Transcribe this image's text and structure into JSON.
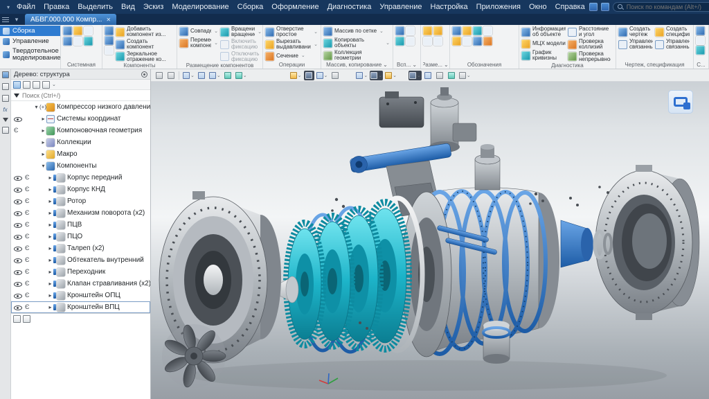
{
  "colors": {
    "menubar_bg": "#17375e",
    "accent_blue": "#2e7bd6",
    "active_tab_top": "#4e93d9",
    "active_tab_bottom": "#2b66a8",
    "ribbon_bg": "#f2f3f4",
    "viewport_top": "#c6ccd1",
    "viewport_bottom": "#999fa6",
    "rotor_cyan": "#1db4c9",
    "part_blue": "#2a63ab"
  },
  "icons": {
    "close": "✕",
    "chevron_down": "⌄",
    "dropdown": "▾",
    "expander_collapsed": "▸",
    "expander_expanded": "▾",
    "exclude_glyph": "Є",
    "fx": "fx",
    "plus_prefix": "(+)"
  },
  "menubar": {
    "items": [
      "Файл",
      "Правка",
      "Выделить",
      "Вид",
      "Эскиз",
      "Моделирование",
      "Сборка",
      "Оформление",
      "Диагностика",
      "Управление",
      "Настройка",
      "Приложения",
      "Окно",
      "Справка"
    ],
    "search_placeholder": "Поиск по командам (Alt+/)"
  },
  "tabbar": {
    "active_tab": "АБВГ.000.000 Компр..."
  },
  "ribbon": {
    "mode_tabs": [
      {
        "label": "Сборка"
      },
      {
        "label": "Управление"
      },
      {
        "label": "Твердотельное моделирование"
      }
    ],
    "groups": {
      "sistemnaya": {
        "label": "Системная"
      },
      "komponenty": {
        "label": "Компоненты",
        "buttons": [
          "Добавить компонент из...",
          "Создать компонент",
          "Зеркальное отражение ко..."
        ]
      },
      "razmeshchenie": {
        "label": "Размещение компонентов",
        "buttons": [
          "Совпадение",
          "Переместить компонент",
          "Вращение-вращение",
          "Включить фиксацию",
          "Отключить фиксацию"
        ]
      },
      "operatsii": {
        "label": "Операции",
        "buttons": [
          "Отверстие простое",
          "Вырезать выдавливанием",
          "Сечение"
        ]
      },
      "massiv": {
        "label": "Массив, копирование",
        "buttons": [
          "Массив по сетке",
          "Копировать объекты",
          "Коллекция геометрии"
        ]
      },
      "vsp": {
        "label": "Всп..."
      },
      "razme": {
        "label": "Разме..."
      },
      "oboznacheniya": {
        "label": "Обозначения"
      },
      "diagnostika": {
        "label": "Диагностика",
        "buttons": [
          "Информация об объекте",
          "МЦХ модели",
          "График кривизны",
          "Расстояние и угол",
          "Проверка коллизий",
          "Проверка непрерывности"
        ]
      },
      "chertezh": {
        "label": "Чертеж, спецификация",
        "buttons": [
          "Создать чертеж по модели",
          "Управление связанными ч...",
          "Создать спецификаци...",
          "Управление связанными..."
        ]
      },
      "s": {
        "label": "С..."
      }
    }
  },
  "tree": {
    "title": "Дерево: структура",
    "search_placeholder": "Поиск (Ctrl+/)",
    "items": [
      {
        "label": "Компрессор низкого давления (Т"
      },
      {
        "label": "Системы координат"
      },
      {
        "label": "Компоновочная геометрия"
      },
      {
        "label": "Коллекции"
      },
      {
        "label": "Макро"
      },
      {
        "label": "Компоненты"
      },
      {
        "label": "Корпус передний"
      },
      {
        "label": "Корпус КНД"
      },
      {
        "label": "Ротор"
      },
      {
        "label": "Механизм поворота (x2)"
      },
      {
        "label": "ПЦВ"
      },
      {
        "label": "ПЦО"
      },
      {
        "label": "Талреп (x2)"
      },
      {
        "label": "Обтекатель внутренний"
      },
      {
        "label": "Переходник"
      },
      {
        "label": "Клапан стравливания (x2)"
      },
      {
        "label": "Кронштейн ОПЦ"
      },
      {
        "label": "Кронштейн ВПЦ"
      }
    ]
  }
}
